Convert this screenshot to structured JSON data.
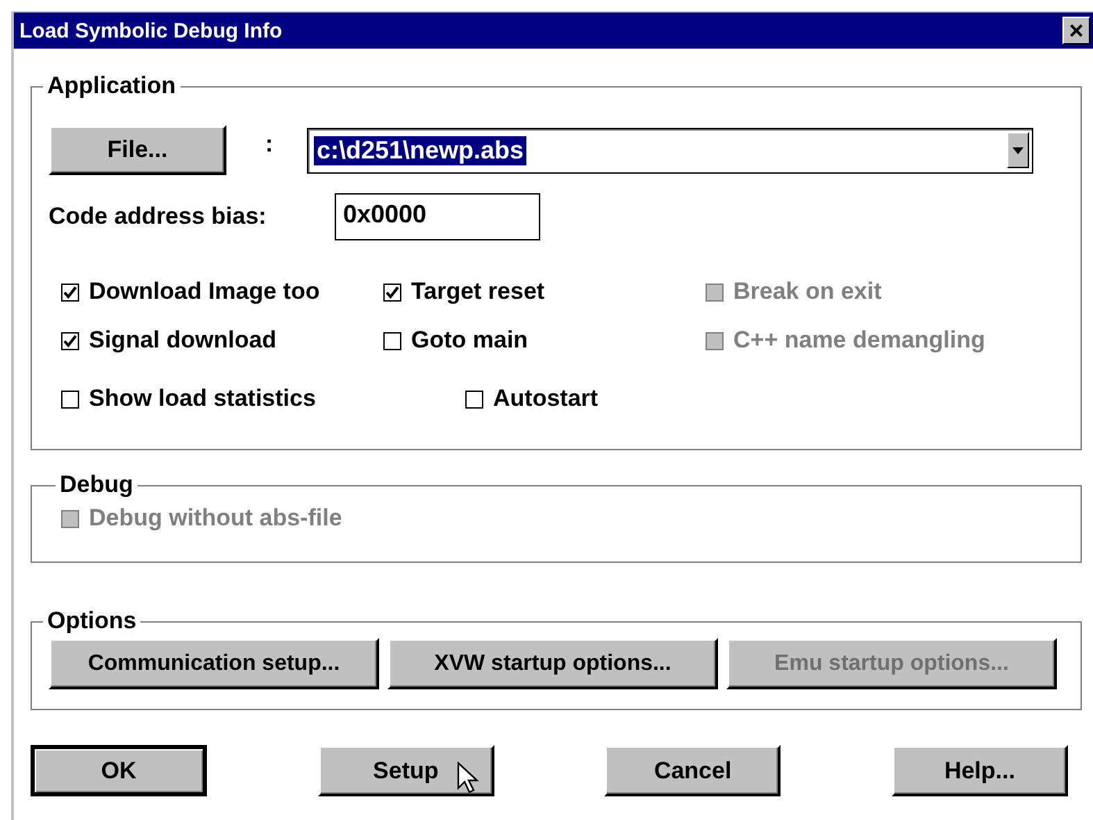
{
  "window": {
    "title": "Load Symbolic Debug Info",
    "close": "×"
  },
  "application": {
    "title": "Application",
    "file_button": "File...",
    "separator": ":",
    "file_field": {
      "value": "c:\\d251\\newp.abs"
    },
    "bias_label": "Code address bias:",
    "bias_field": {
      "value": "0x0000"
    },
    "checkbox_rows": [
      [
        {
          "label": "Download Image too",
          "checked": true,
          "disabled": false
        },
        {
          "label": "Target reset",
          "checked": true,
          "disabled": false
        },
        {
          "label": "Break on exit",
          "checked": false,
          "disabled": true
        }
      ],
      [
        {
          "label": "Signal download",
          "checked": true,
          "disabled": false
        },
        {
          "label": "Goto main",
          "checked": false,
          "disabled": false
        },
        {
          "label": "C++ name demangling",
          "checked": false,
          "disabled": true
        }
      ],
      [
        {
          "label": "Show load statistics",
          "checked": false,
          "disabled": false
        },
        {
          "label": "Autostart",
          "checked": false,
          "disabled": false
        }
      ]
    ]
  },
  "debug": {
    "title": "Debug",
    "checkboxes": [
      {
        "label": "Debug without abs-file",
        "checked": false,
        "disabled": true
      }
    ]
  },
  "options": {
    "title": "Options",
    "buttons": [
      {
        "label": "Communication setup...",
        "disabled": false
      },
      {
        "label": "XVW startup options...",
        "disabled": false
      },
      {
        "label": "Emu startup options...",
        "disabled": true
      }
    ]
  },
  "buttons": [
    {
      "label": "OK",
      "default": true,
      "hovered": false
    },
    {
      "label": "Setup",
      "default": false,
      "hovered": true
    },
    {
      "label": "Cancel",
      "default": false,
      "hovered": false
    },
    {
      "label": "Help...",
      "default": false,
      "hovered": false
    }
  ]
}
